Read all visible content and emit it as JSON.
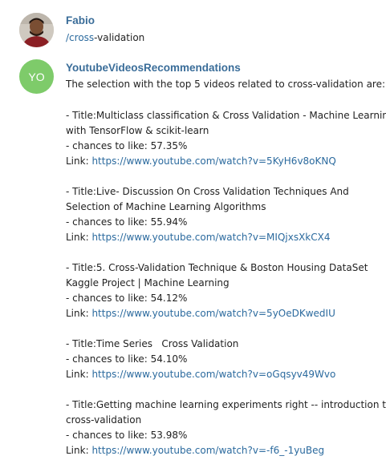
{
  "messages": [
    {
      "sender": "Fabio",
      "command_slash": "/",
      "command_word": "cross",
      "command_rest": "-validation"
    },
    {
      "sender": "YoutubeVideosRecommendations",
      "avatar_initials": "YO",
      "intro": "The selection with the top 5 videos related to cross-validation are:",
      "link_prefix": "Link: ",
      "videos": [
        {
          "title_line1": "- Title:Multiclass classification & Cross Validation - Machine Learning",
          "title_line2": "with TensorFlow & scikit-learn",
          "chance": "- chances to like: 57.35%",
          "url": "https://www.youtube.com/watch?v=5KyH6v8oKNQ"
        },
        {
          "title_line1": "- Title:Live- Discussion On Cross Validation Techniques And",
          "title_line2": "Selection of Machine Learning Algorithms",
          "chance": "- chances to like: 55.94%",
          "url": "https://www.youtube.com/watch?v=MIQjxsXkCX4"
        },
        {
          "title_line1": "- Title:5. Cross-Validation Technique & Boston Housing DataSet",
          "title_line2": "Kaggle Project | Machine Learning",
          "chance": "- chances to like: 54.12%",
          "url": "https://www.youtube.com/watch?v=5yOeDKwedIU"
        },
        {
          "title_line1": "- Title:Time Series   Cross Validation",
          "chance": "- chances to like: 54.10%",
          "url": "https://www.youtube.com/watch?v=oGqsyv49Wvo"
        },
        {
          "title_line1": "- Title:Getting machine learning experiments right -- introduction to",
          "title_line2": "cross-validation",
          "chance": "- chances to like: 53.98%",
          "url": "https://www.youtube.com/watch?v=-f6_-1yuBeg"
        }
      ]
    }
  ],
  "colors": {
    "sender_name": "#3a6d99",
    "link": "#2b6a9e",
    "bot_avatar_bg": "#7ecb6a",
    "text": "#222222"
  },
  "icons": {
    "user_avatar": "user-photo-avatar",
    "bot_avatar": "bot-initials-avatar"
  }
}
